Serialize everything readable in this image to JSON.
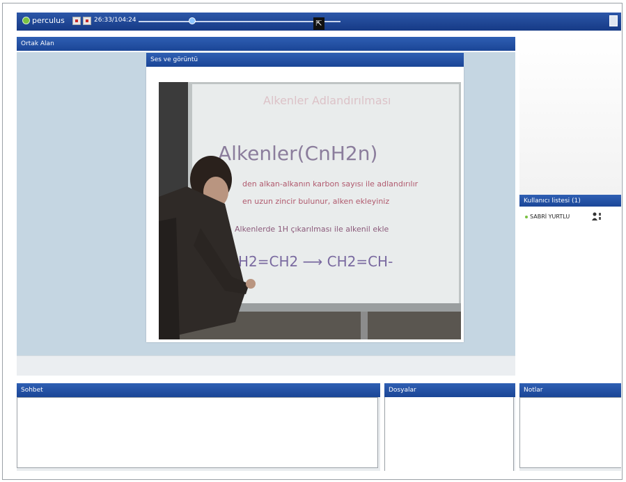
{
  "toolbar": {
    "logo": "perculus",
    "timecode": "26:33/104:24",
    "playback_progress": 0.33,
    "popout_icon": "external-link-icon",
    "save_icon": "save-icon"
  },
  "panels": {
    "ortak_alan": {
      "title": "Ortak Alan"
    },
    "ses_goruntu": {
      "title": "Ses ve görüntü"
    },
    "kullanici_listesi": {
      "title": "Kullanıcı listesi (1)",
      "users": [
        {
          "name": "SABRİ YURTLU",
          "icon": "user-icon"
        }
      ]
    },
    "sohbet": {
      "title": "Sohbet"
    },
    "dosyalar": {
      "title": "Dosyalar"
    },
    "notlar": {
      "title": "Notlar"
    }
  },
  "video": {
    "whiteboard_lines": [
      "Alkenler(CnH2n)",
      "CH2=CH2 ⟶ CH2=CH-"
    ]
  },
  "colors": {
    "header_blue": "#1a4596",
    "panel_bg": "#c5d6e2",
    "accent_green": "#7ac142"
  }
}
